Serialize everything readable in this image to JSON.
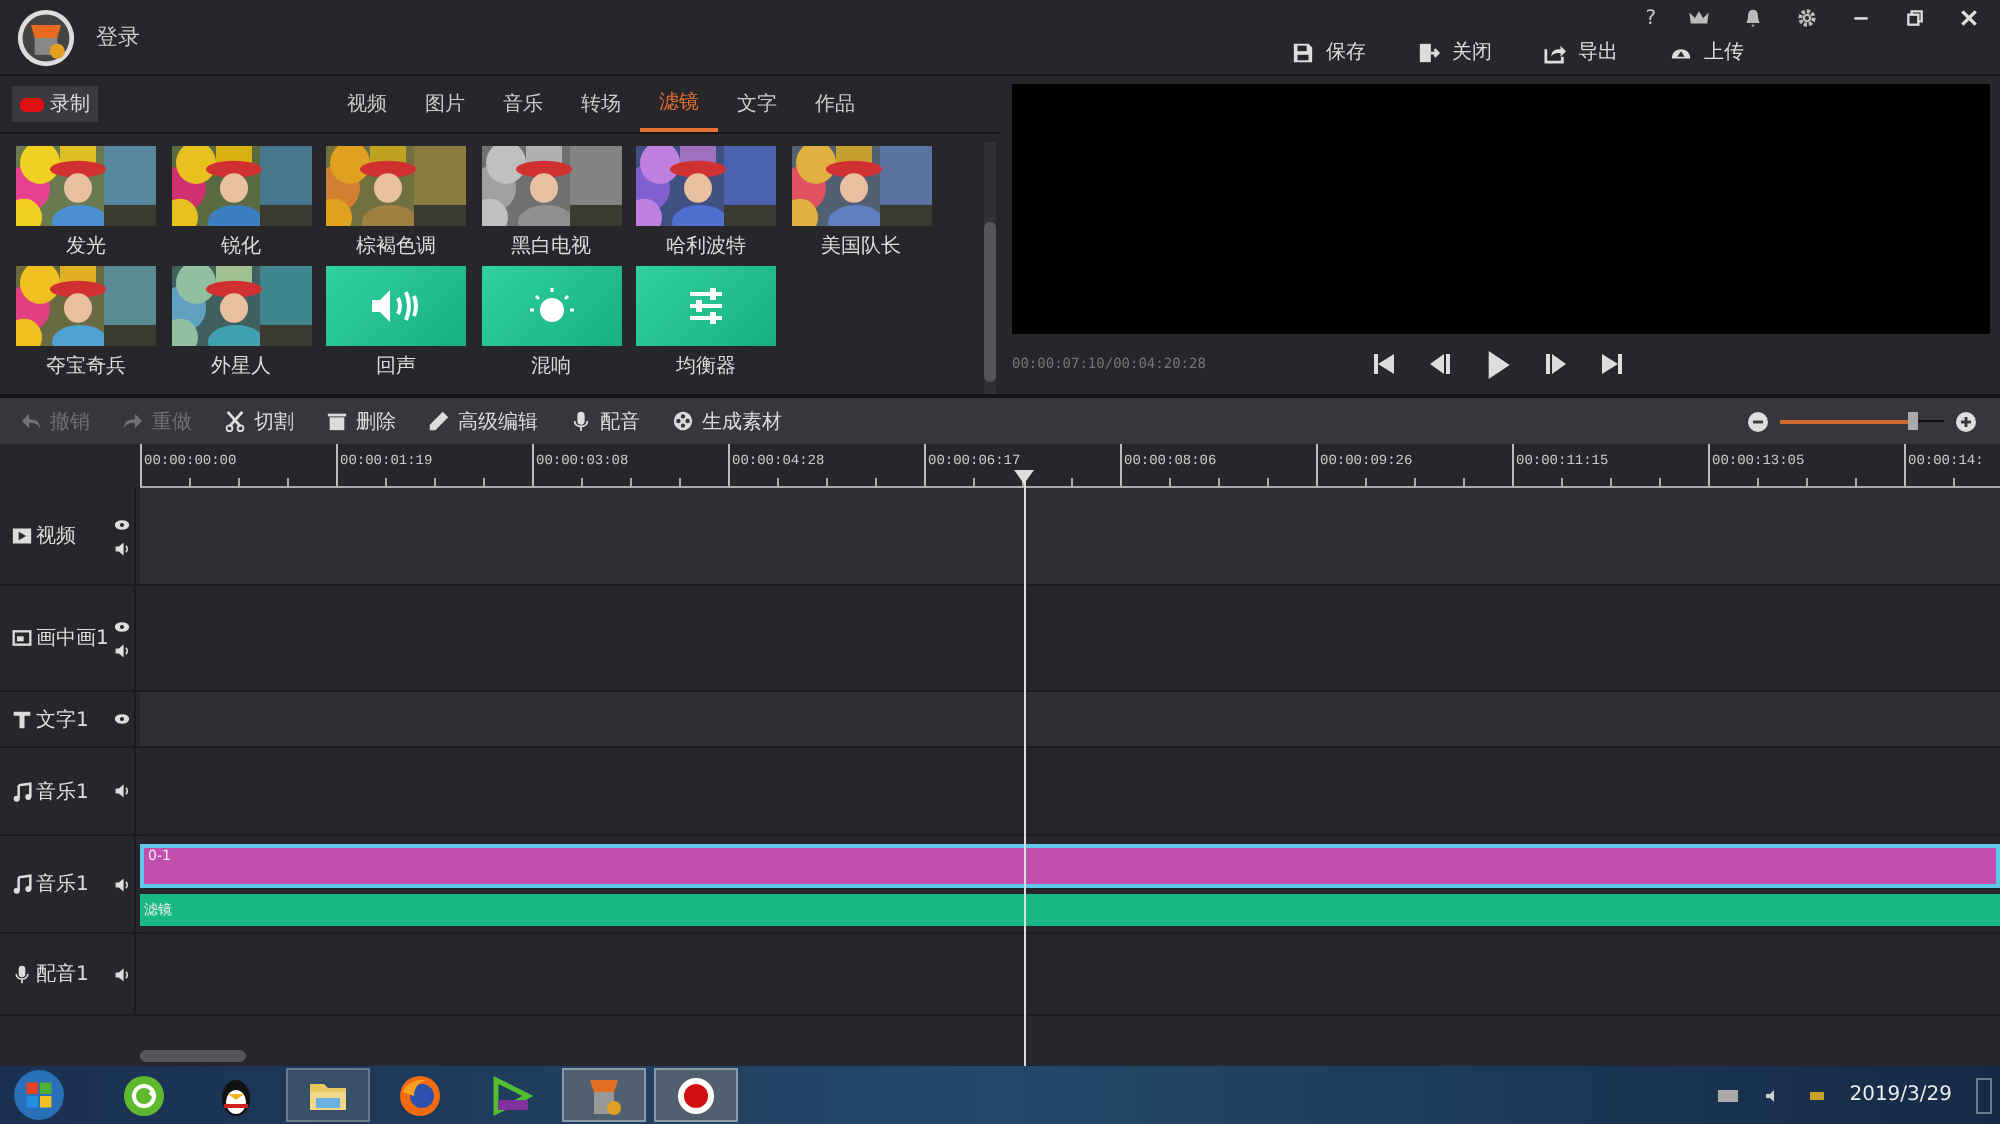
{
  "header": {
    "login": "登录",
    "help": "?"
  },
  "actions": [
    {
      "label": "保存",
      "kind": "save"
    },
    {
      "label": "关闭",
      "kind": "close"
    },
    {
      "label": "导出",
      "kind": "export"
    },
    {
      "label": "上传",
      "kind": "upload"
    }
  ],
  "record_button": "录制",
  "tabs": [
    {
      "label": "视频",
      "selected": false
    },
    {
      "label": "图片",
      "selected": false
    },
    {
      "label": "音乐",
      "selected": false
    },
    {
      "label": "转场",
      "selected": false
    },
    {
      "label": "滤镜",
      "selected": true
    },
    {
      "label": "文字",
      "selected": false
    },
    {
      "label": "作品",
      "selected": false
    }
  ],
  "effects": [
    {
      "label": "发光",
      "kind": "picture"
    },
    {
      "label": "锐化",
      "kind": "picture"
    },
    {
      "label": "棕褐色调",
      "kind": "picture"
    },
    {
      "label": "黑白电视",
      "kind": "picture"
    },
    {
      "label": "哈利波特",
      "kind": "picture"
    },
    {
      "label": "美国队长",
      "kind": "picture"
    },
    {
      "label": "夺宝奇兵",
      "kind": "picture"
    },
    {
      "label": "外星人",
      "kind": "picture"
    },
    {
      "label": "回声",
      "kind": "echo"
    },
    {
      "label": "混响",
      "kind": "reverb"
    },
    {
      "label": "均衡器",
      "kind": "equalizer"
    }
  ],
  "preview": {
    "time": "00:00:07:10/00:04:20:28"
  },
  "toolbar": [
    {
      "label": "撤销",
      "kind": "undo",
      "disabled": true
    },
    {
      "label": "重做",
      "kind": "redo",
      "disabled": true
    },
    {
      "label": "切割",
      "kind": "cut",
      "disabled": false
    },
    {
      "label": "删除",
      "kind": "delete",
      "disabled": false
    },
    {
      "label": "高级编辑",
      "kind": "edit",
      "disabled": false
    },
    {
      "label": "配音",
      "kind": "mic",
      "disabled": false
    },
    {
      "label": "生成素材",
      "kind": "film",
      "disabled": false
    }
  ],
  "zoom": {
    "level": 0.82
  },
  "ruler": [
    "00:00:00:00",
    "00:00:01:19",
    "00:00:03:08",
    "00:00:04:28",
    "00:00:06:17",
    "00:00:08:06",
    "00:00:09:26",
    "00:00:11:15",
    "00:00:13:05",
    "00:00:14:"
  ],
  "playhead": {
    "level": 0.475
  },
  "tracks": [
    {
      "label": "视频",
      "kind": "video"
    },
    {
      "label": "画中画1",
      "kind": "pip"
    },
    {
      "label": "文字1",
      "kind": "text"
    },
    {
      "label": "音乐1",
      "kind": "music"
    },
    {
      "label": "音乐1",
      "kind": "music",
      "clips": [
        {
          "label": "0-1",
          "kind": "audio",
          "selected": true
        },
        {
          "label": "滤镜",
          "kind": "filter",
          "selected": false
        }
      ]
    },
    {
      "label": "配音1",
      "kind": "voice"
    }
  ],
  "taskbar": {
    "date": "2019/3/29"
  }
}
